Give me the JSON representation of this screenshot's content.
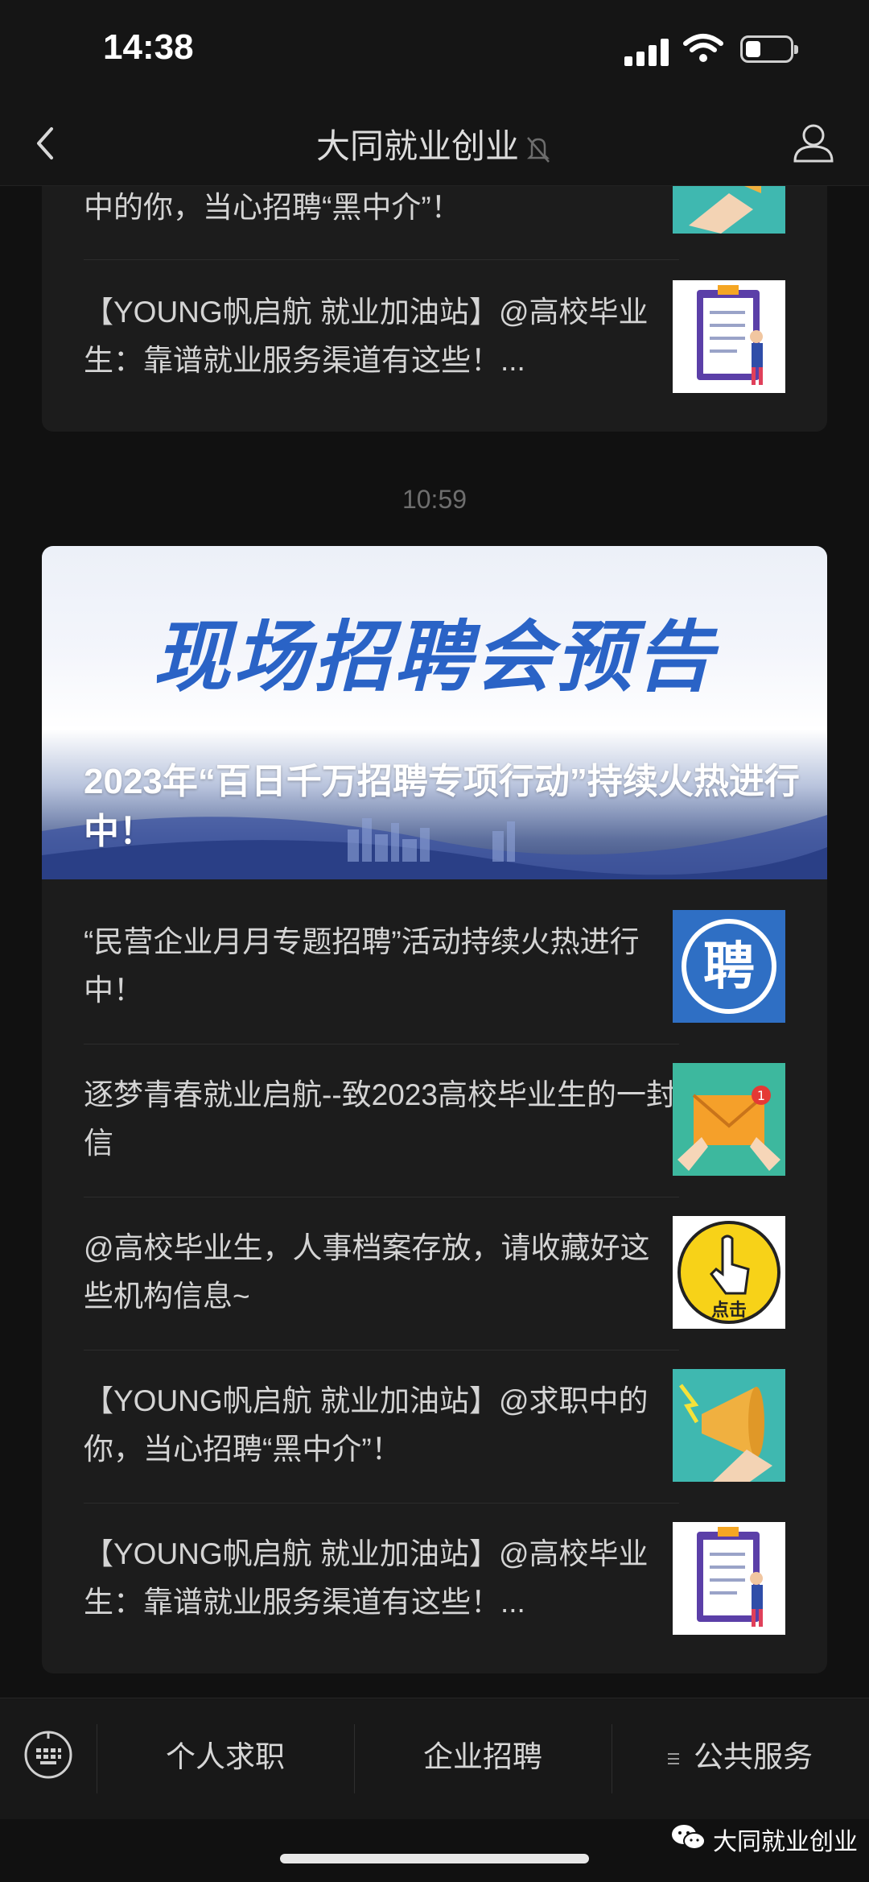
{
  "status_bar": {
    "time": "14:38"
  },
  "nav": {
    "title": "大同就业创业"
  },
  "top_card": {
    "articles": [
      {
        "title": "中的你，当心招聘“黑中介”！",
        "thumb": "megaphone"
      },
      {
        "title": "【YOUNG帆启航 就业加油站】@高校毕业生：靠谱就业服务渠道有这些！...",
        "thumb": "checklist"
      }
    ]
  },
  "timestamp": "10:59",
  "main_card": {
    "banner": {
      "headline": "现场招聘会预告",
      "title": "2023年“百日千万招聘专项行动”持续火热进行中！"
    },
    "articles": [
      {
        "title": "“民营企业月月专题招聘”活动持续火热进行中！",
        "thumb": "hire-badge",
        "thumb_text": "聘"
      },
      {
        "title": "逐梦青春就业启航--致2023高校毕业生的一封信",
        "thumb": "envelope",
        "thumb_badge": "1"
      },
      {
        "title": "@高校毕业生，人事档案存放，请收藏好这些机构信息~",
        "thumb": "click-button",
        "thumb_text": "点击"
      },
      {
        "title": "【YOUNG帆启航 就业加油站】@求职中的你，当心招聘“黑中介”！",
        "thumb": "megaphone"
      },
      {
        "title": "【YOUNG帆启航 就业加油站】@高校毕业生：靠谱就业服务渠道有这些！...",
        "thumb": "checklist"
      }
    ]
  },
  "bottom_menu": {
    "items": [
      "个人求职",
      "企业招聘",
      "公共服务"
    ]
  },
  "watermark": "大同就业创业",
  "colors": {
    "background": "#111111",
    "card": "#1c1c1c",
    "banner_blue": "#2a63c6"
  }
}
